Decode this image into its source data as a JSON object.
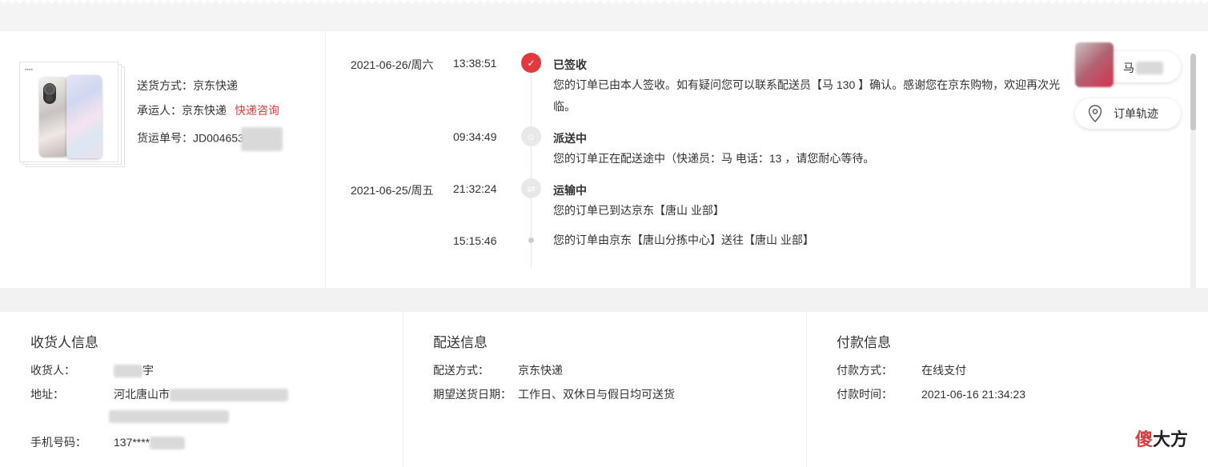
{
  "shipment": {
    "method_label": "送货方式：",
    "method_value": "京东快递",
    "carrier_label": "承运人：",
    "carrier_value": "京东快递",
    "carrier_link": "快递咨询",
    "waybill_label": "货运单号：",
    "waybill_value": "JD004653"
  },
  "tracking": {
    "entries": [
      {
        "date": "2021-06-26/周六",
        "time": "13:38:51",
        "status": "已签收",
        "desc": "您的订单已由本人签收。如有疑问您可以联系配送员【马 130 】确认。感谢您在京东购物，欢迎再次光临。",
        "icon": "check-icon"
      },
      {
        "date": "",
        "time": "09:34:49",
        "status": "派送中",
        "desc": "您的订单正在配送途中（快递员：马 电话：13 ，请您耐心等待。",
        "icon": "courier-icon"
      },
      {
        "date": "2021-06-25/周五",
        "time": "21:32:24",
        "status": "运输中",
        "desc": "您的订单已到达京东【唐山 业部】",
        "icon": "truck-icon"
      },
      {
        "date": "",
        "time": "15:15:46",
        "status": "",
        "desc": "您的订单由京东【唐山分拣中心】送往【唐山 业部】",
        "icon": "dot-icon"
      }
    ],
    "courier_name": "马",
    "track_button": "订单轨迹"
  },
  "receiver": {
    "title": "收货人信息",
    "name_label": "收货人：",
    "name_value": "宇",
    "address_label": "地址：",
    "address_value": "河北唐山市",
    "phone_label": "手机号码：",
    "phone_value": "137****"
  },
  "delivery": {
    "title": "配送信息",
    "method_label": "配送方式：",
    "method_value": "京东快递",
    "expected_label": "期望送货日期：",
    "expected_value": "工作日、双休日与假日均可送货"
  },
  "payment": {
    "title": "付款信息",
    "method_label": "付款方式：",
    "method_value": "在线支付",
    "time_label": "付款时间：",
    "time_value": "2021-06-16 21:34:23"
  },
  "watermark": {
    "red": "傻",
    "black": "大方"
  },
  "colors": {
    "accent": "#e4393c",
    "text": "#333333",
    "border": "#eeeeee"
  }
}
